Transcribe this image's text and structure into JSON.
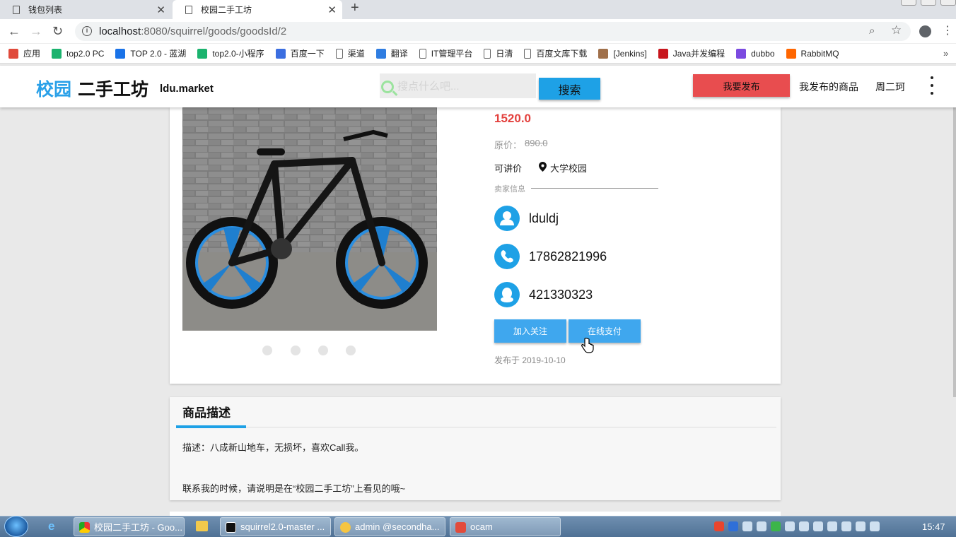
{
  "browser": {
    "tabs": [
      {
        "title": "钱包列表",
        "active": false
      },
      {
        "title": "校园二手工坊",
        "active": true
      }
    ],
    "url_host": "localhost",
    "url_path": ":8080/squirrel/goods/goodsId/2",
    "bookmarks": [
      {
        "label": "应用",
        "icon": "apps-grid-icon",
        "color": "#e04a3b"
      },
      {
        "label": "top2.0 PC",
        "icon": "play-icon",
        "color": "#1bb36e"
      },
      {
        "label": "TOP 2.0 - 蓝湖",
        "icon": "lanhu-icon",
        "color": "#1a73e8"
      },
      {
        "label": "top2.0-小程序",
        "icon": "play-icon",
        "color": "#1bb36e"
      },
      {
        "label": "百度一下",
        "icon": "baidu-paw-icon",
        "color": "#3b6ee0"
      },
      {
        "label": "渠道",
        "icon": "page-icon",
        "color": "#666666"
      },
      {
        "label": "翻译",
        "icon": "translate-icon",
        "color": "#2f7de1"
      },
      {
        "label": "IT管理平台",
        "icon": "page-icon",
        "color": "#666666"
      },
      {
        "label": "日清",
        "icon": "page-icon",
        "color": "#666666"
      },
      {
        "label": "百度文库下载",
        "icon": "page-icon",
        "color": "#666666"
      },
      {
        "label": "[Jenkins]",
        "icon": "jenkins-icon",
        "color": "#a0704a"
      },
      {
        "label": "Java并发编程",
        "icon": "csdn-icon",
        "color": "#c8161d"
      },
      {
        "label": "dubbo",
        "icon": "dubbo-icon",
        "color": "#7b4ae0"
      },
      {
        "label": "RabbitMQ",
        "icon": "rabbitmq-icon",
        "color": "#f60"
      }
    ]
  },
  "header": {
    "logo_part1": "校园",
    "logo_part2": "二手工坊",
    "logo_sub": "ldu.market",
    "search_placeholder": "搜点什么吧...",
    "search_button": "搜索",
    "publish_button": "我要发布",
    "my_goods": "我发布的商品",
    "username": "周二珂"
  },
  "product": {
    "price": "1520.0",
    "original_label": "原价：",
    "original_price": "890.0",
    "negotiable": "可讲价",
    "location": "大学校园",
    "seller_section": "卖家信息",
    "seller_name": "lduldj",
    "seller_phone": "17862821996",
    "seller_qq": "421330323",
    "follow_button": "加入关注",
    "pay_button": "在线支付",
    "published": "发布于 2019-10-10",
    "carousel_count": 4
  },
  "description": {
    "title": "商品描述",
    "line1": "描述：八成新山地车，无损坏，喜欢Call我。",
    "line2": "联系我的时候，请说明是在“校园二手工坊”上看见的哦~"
  },
  "taskbar": {
    "items": [
      {
        "label": "校园二手工坊 - Goo...",
        "icon": "chrome-icon"
      },
      {
        "label": "squirrel2.0-master ...",
        "icon": "intellij-icon"
      },
      {
        "label": "admin @secondha...",
        "icon": "db-icon"
      },
      {
        "label": "ocam",
        "icon": "ocam-icon"
      }
    ],
    "clock": "15:47"
  },
  "colors": {
    "accent": "#1ea1e6",
    "price": "#e3403d",
    "publish": "#e84d4f"
  }
}
